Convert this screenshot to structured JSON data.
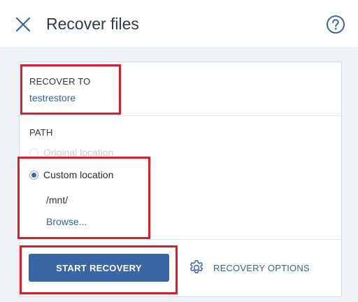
{
  "header": {
    "title": "Recover files"
  },
  "recover_to": {
    "label": "RECOVER TO",
    "value": "testrestore"
  },
  "path": {
    "label": "PATH",
    "options": [
      {
        "label": "Original location",
        "selected": false,
        "disabled": true
      },
      {
        "label": "Custom location",
        "selected": true,
        "disabled": false
      }
    ],
    "custom_value": "/mnt/",
    "browse_label": "Browse..."
  },
  "actions": {
    "start_label": "START RECOVERY",
    "options_label": "RECOVERY OPTIONS"
  },
  "colors": {
    "accent": "#3a66a6",
    "link": "#3560a4",
    "highlight": "#d8202d"
  },
  "icons": [
    "close-icon",
    "help-icon",
    "gear-icon"
  ]
}
